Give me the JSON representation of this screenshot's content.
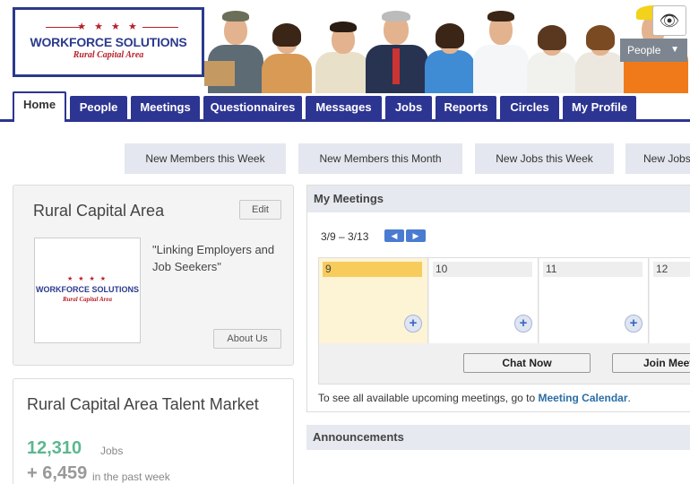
{
  "logo": {
    "stars": "★ ★ ★ ★",
    "title": "WORKFORCE SOLUTIONS",
    "subtitle": "Rural Capital Area"
  },
  "header": {
    "eye_icon": "eye-icon",
    "view_dropdown": {
      "label": "People",
      "arrow": "▼"
    }
  },
  "nav": {
    "tabs": [
      {
        "label": "Home",
        "active": true
      },
      {
        "label": "People"
      },
      {
        "label": "Meetings"
      },
      {
        "label": "Questionnaires"
      },
      {
        "label": "Messages"
      },
      {
        "label": "Jobs"
      },
      {
        "label": "Reports"
      },
      {
        "label": "Circles"
      },
      {
        "label": "My Profile"
      }
    ]
  },
  "stats_buttons": [
    "New Members this Week",
    "New Members this Month",
    "New Jobs this Week",
    "New Jobs"
  ],
  "org_panel": {
    "name": "Rural Capital Area",
    "edit_label": "Edit",
    "quote": "\"Linking Employers and Job Seekers\"",
    "about_label": "About Us",
    "logo_stars": "★ ★ ★ ★",
    "logo_title": "WORKFORCE SOLUTIONS",
    "logo_subtitle": "Rural Capital Area"
  },
  "talent_market": {
    "title": "Rural Capital Area Talent Market",
    "jobs_count": "12,310",
    "jobs_label": "Jobs",
    "week_count": "+ 6,459",
    "week_label": "in the past week",
    "colors": {
      "jobs": "#5cb88f",
      "week": "#999999"
    }
  },
  "meetings": {
    "title": "My Meetings",
    "range": "3/9 – 3/13",
    "prev_icon": "◀",
    "next_icon": "▶",
    "days": [
      {
        "label": "9",
        "today": true
      },
      {
        "label": "10"
      },
      {
        "label": "11"
      },
      {
        "label": "12"
      }
    ],
    "add_icon": "+",
    "chat_label": "Chat Now",
    "join_label": "Join Meeting",
    "note_prefix": "To see all available upcoming meetings, go to ",
    "note_link": "Meeting Calendar",
    "note_suffix": "."
  },
  "announcements": {
    "title": "Announcements"
  },
  "colors": {
    "nav": "#2d3592",
    "accent_red": "#b8202a",
    "today": "#f7cc5c"
  }
}
